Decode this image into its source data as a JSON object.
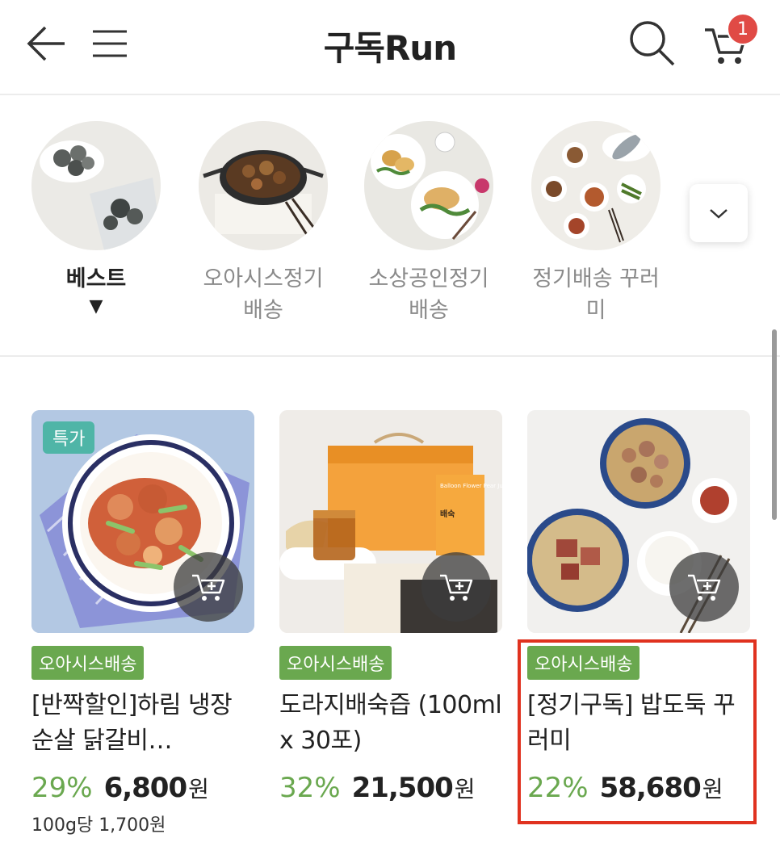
{
  "header": {
    "title": "구독Run",
    "cart_count": "1"
  },
  "categories": [
    {
      "label": "베스트",
      "active": true,
      "indicator": "▼"
    },
    {
      "label": "오아시스정기배송",
      "active": false
    },
    {
      "label": "소상공인정기배송",
      "active": false
    },
    {
      "label": "정기배송 꾸러미",
      "active": false
    }
  ],
  "products": [
    {
      "special": "특가",
      "tag": "오아시스배송",
      "name": "[반짝할인]하림 냉장 순살 닭갈비…",
      "discount": "29%",
      "price": "6,800",
      "currency": "원",
      "unit_price": "100g당 1,700원"
    },
    {
      "tag": "오아시스배송",
      "name": "도라지배숙즙 (100ml x 30포)",
      "discount": "32%",
      "price": "21,500",
      "currency": "원",
      "box_text": "Balloon Flower Pear Juice",
      "box_brand": "배숙"
    },
    {
      "tag": "오아시스배송",
      "name": "[정기구독] 밥도둑 꾸러미",
      "discount": "22%",
      "price": "58,680",
      "currency": "원"
    }
  ],
  "colors": {
    "accent_green": "#6aa84f",
    "special_teal": "#4fb5a7",
    "badge_red": "#e04a45",
    "highlight_red": "#e0321f"
  },
  "icons": [
    "back-arrow-icon",
    "menu-icon",
    "search-icon",
    "cart-icon",
    "chevron-down-icon",
    "add-to-cart-icon"
  ]
}
